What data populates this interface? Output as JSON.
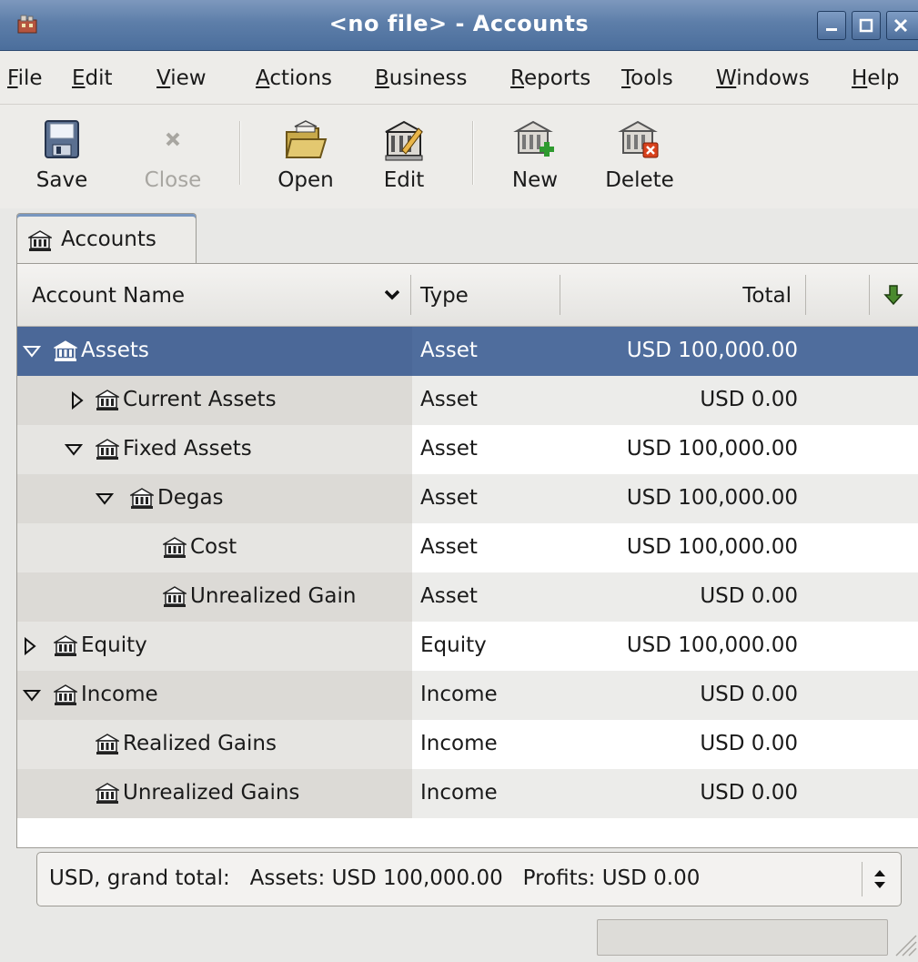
{
  "window": {
    "title": "<no file> - Accounts"
  },
  "menubar": {
    "items": [
      {
        "label": "File",
        "mnemonic": "F",
        "rest": "ile"
      },
      {
        "label": "Edit",
        "mnemonic": "E",
        "rest": "dit"
      },
      {
        "label": "View",
        "mnemonic": "V",
        "rest": "iew"
      },
      {
        "label": "Actions",
        "mnemonic": "A",
        "rest": "ctions"
      },
      {
        "label": "Business",
        "mnemonic": "B",
        "rest": "usiness"
      },
      {
        "label": "Reports",
        "mnemonic": "R",
        "rest": "eports"
      },
      {
        "label": "Tools",
        "mnemonic": "T",
        "rest": "ools"
      },
      {
        "label": "Windows",
        "mnemonic": "W",
        "rest": "indows"
      },
      {
        "label": "Help",
        "mnemonic": "H",
        "rest": "elp"
      }
    ]
  },
  "toolbar": {
    "save": {
      "label": "Save",
      "icon": "save-icon"
    },
    "close": {
      "label": "Close",
      "icon": "close-icon",
      "enabled": false
    },
    "open": {
      "label": "Open",
      "icon": "open-folder-icon"
    },
    "edit": {
      "label": "Edit",
      "icon": "edit-account-icon"
    },
    "new": {
      "label": "New",
      "icon": "new-account-icon"
    },
    "delete": {
      "label": "Delete",
      "icon": "delete-account-icon"
    }
  },
  "tabs": [
    {
      "label": "Accounts",
      "icon": "account-bank-icon",
      "active": true
    }
  ],
  "tree": {
    "columns": {
      "name": "Account Name",
      "type": "Type",
      "total": "Total"
    },
    "rows": [
      {
        "name": "Assets",
        "type": "Asset",
        "total": "USD 100,000.00",
        "depth": 0,
        "expander": "expanded",
        "selected": true
      },
      {
        "name": "Current Assets",
        "type": "Asset",
        "total": "USD 0.00",
        "depth": 1,
        "expander": "collapsed"
      },
      {
        "name": "Fixed Assets",
        "type": "Asset",
        "total": "USD 100,000.00",
        "depth": 1,
        "expander": "expanded"
      },
      {
        "name": "Degas",
        "type": "Asset",
        "total": "USD 100,000.00",
        "depth": 2,
        "expander": "expanded"
      },
      {
        "name": "Cost",
        "type": "Asset",
        "total": "USD 100,000.00",
        "depth": 3,
        "expander": "none"
      },
      {
        "name": "Unrealized Gain",
        "type": "Asset",
        "total": "USD 0.00",
        "depth": 3,
        "expander": "none"
      },
      {
        "name": "Equity",
        "type": "Equity",
        "total": "USD 100,000.00",
        "depth": 0,
        "expander": "collapsed"
      },
      {
        "name": "Income",
        "type": "Income",
        "total": "USD 0.00",
        "depth": 0,
        "expander": "expanded"
      },
      {
        "name": "Realized Gains",
        "type": "Income",
        "total": "USD 0.00",
        "depth": 1,
        "expander": "none"
      },
      {
        "name": "Unrealized Gains",
        "type": "Income",
        "total": "USD 0.00",
        "depth": 1,
        "expander": "none"
      }
    ]
  },
  "summary": {
    "text": "USD, grand total:   Assets: USD 100,000.00   Profits: USD 0.00"
  },
  "colors": {
    "titlebar": "#5d7ea9",
    "selection": "#4f6d9d"
  }
}
